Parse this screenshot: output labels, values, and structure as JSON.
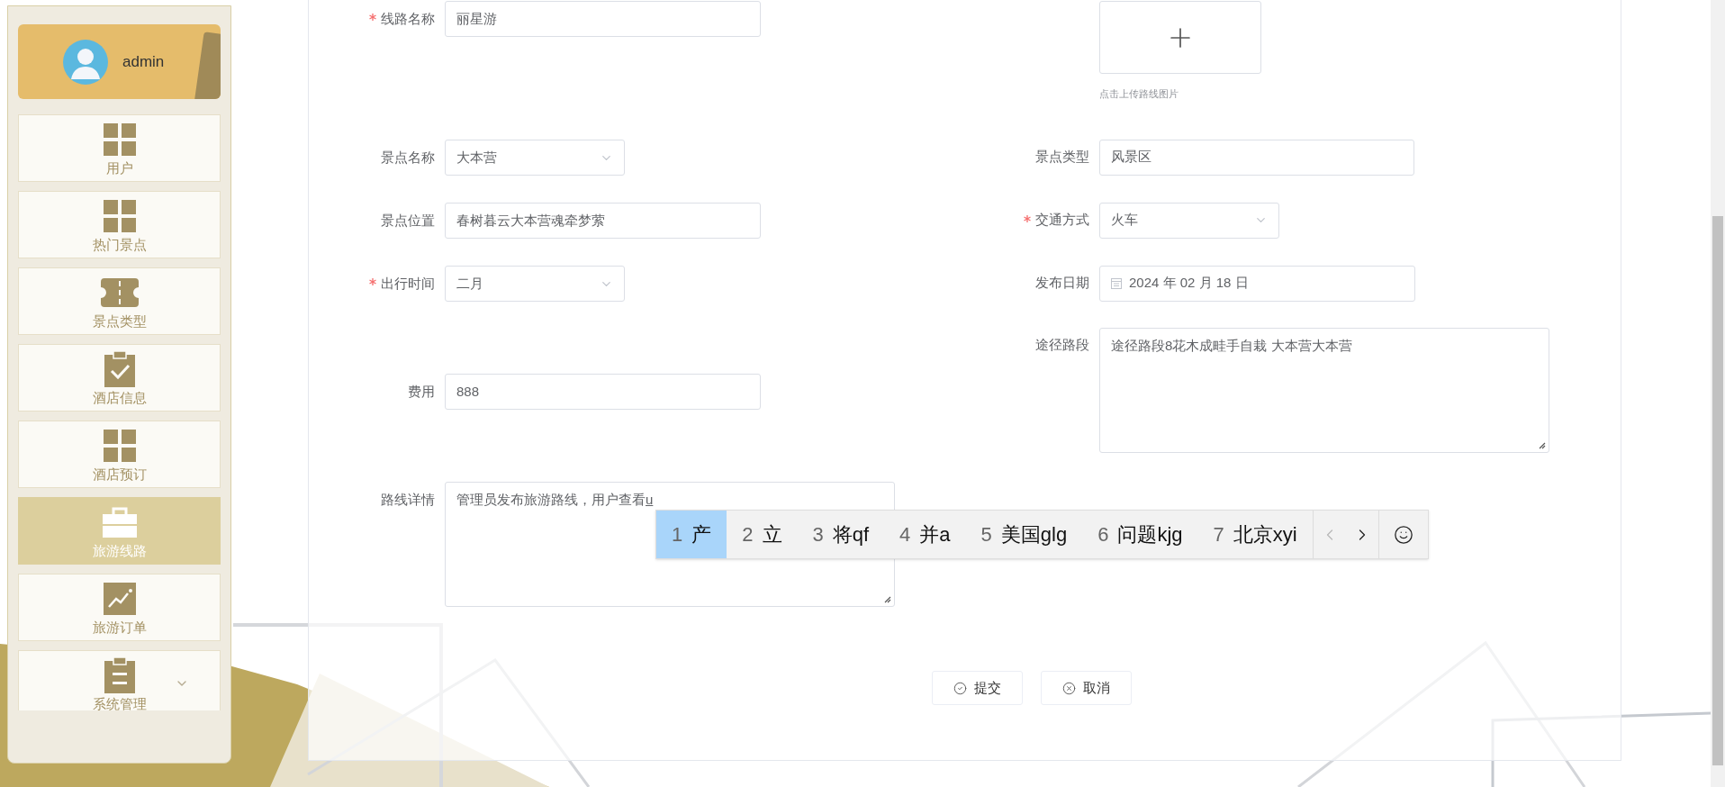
{
  "sidebar": {
    "user": {
      "name": "admin"
    },
    "items": [
      {
        "label": "用户",
        "selected": false
      },
      {
        "label": "热门景点",
        "selected": false
      },
      {
        "label": "景点类型",
        "selected": false
      },
      {
        "label": "酒店信息",
        "selected": false
      },
      {
        "label": "酒店预订",
        "selected": false
      },
      {
        "label": "旅游线路",
        "selected": true
      },
      {
        "label": "旅游订单",
        "selected": false
      },
      {
        "label": "系统管理",
        "selected": false,
        "expanded": false
      }
    ]
  },
  "form": {
    "left": [
      {
        "label": "线路名称",
        "kind": "input",
        "value": "丽星游",
        "required": true
      },
      {
        "label": "景点名称",
        "kind": "select",
        "value": "大本营",
        "required": false
      },
      {
        "label": "景点位置",
        "kind": "input",
        "value": "春树暮云大本营魂牵梦萦",
        "required": false
      },
      {
        "label": "出行时间",
        "kind": "select",
        "value": "二月",
        "required": true
      },
      {
        "label": "费用",
        "kind": "input",
        "value": "888",
        "required": false
      },
      {
        "label": "路线详情",
        "kind": "textarea",
        "value": "管理员发布旅游路线，用户查看",
        "composition": "u",
        "required": false
      }
    ],
    "upload": {
      "caption": "点击上传路线图片"
    },
    "right": [
      {
        "label": "景点类型",
        "kind": "input",
        "value": "风景区",
        "required": false
      },
      {
        "label": "交通方式",
        "kind": "select",
        "value": "火车",
        "required": true
      },
      {
        "label": "发布日期",
        "kind": "date",
        "value": "2024 年 02 月 18 日",
        "required": false
      },
      {
        "label": "途径路段",
        "kind": "textarea",
        "value": "途径路段8花木成畦手自栽 大本营大本营",
        "required": false
      }
    ],
    "buttons": [
      {
        "label": "提交",
        "kind": "submit"
      },
      {
        "label": "取消",
        "kind": "cancel"
      }
    ]
  },
  "ime": {
    "candidates": [
      {
        "index": "1",
        "text": "产",
        "selected": true
      },
      {
        "index": "2",
        "text": "立",
        "selected": false
      },
      {
        "index": "3",
        "text": "将qf",
        "selected": false
      },
      {
        "index": "4",
        "text": "并a",
        "selected": false
      },
      {
        "index": "5",
        "text": "美国glg",
        "selected": false
      },
      {
        "index": "6",
        "text": "问题kjg",
        "selected": false
      },
      {
        "index": "7",
        "text": "北京xyi",
        "selected": false
      }
    ],
    "prev": {
      "disabled": true
    },
    "next": {
      "disabled": false
    }
  }
}
